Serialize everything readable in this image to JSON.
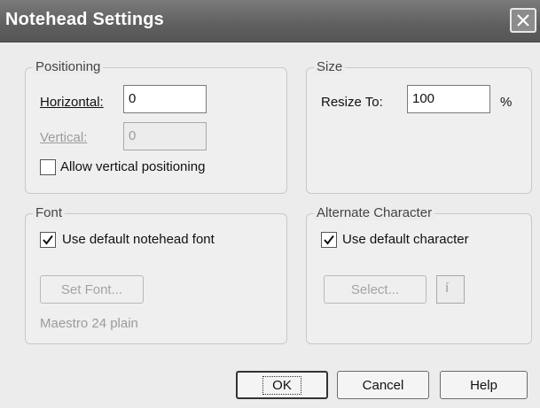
{
  "window": {
    "title": "Notehead Settings"
  },
  "positioning": {
    "label": "Positioning",
    "horizontal_label": "Horizontal:",
    "horizontal_value": "0",
    "vertical_label": "Vertical:",
    "vertical_value": "0",
    "allow_vertical_label": "Allow vertical positioning",
    "allow_vertical_checked": false
  },
  "size": {
    "label": "Size",
    "resize_label": "Resize To:",
    "resize_value": "100",
    "unit": "%"
  },
  "font": {
    "label": "Font",
    "use_default_label": "Use default notehead font",
    "use_default_checked": true,
    "set_font_label": "Set Font...",
    "current_font": "Maestro 24 plain"
  },
  "alternate_character": {
    "label": "Alternate Character",
    "use_default_label": "Use default character",
    "use_default_checked": true,
    "select_label": "Select...",
    "preview_char": "í"
  },
  "buttons": {
    "ok": "OK",
    "cancel": "Cancel",
    "help": "Help"
  }
}
